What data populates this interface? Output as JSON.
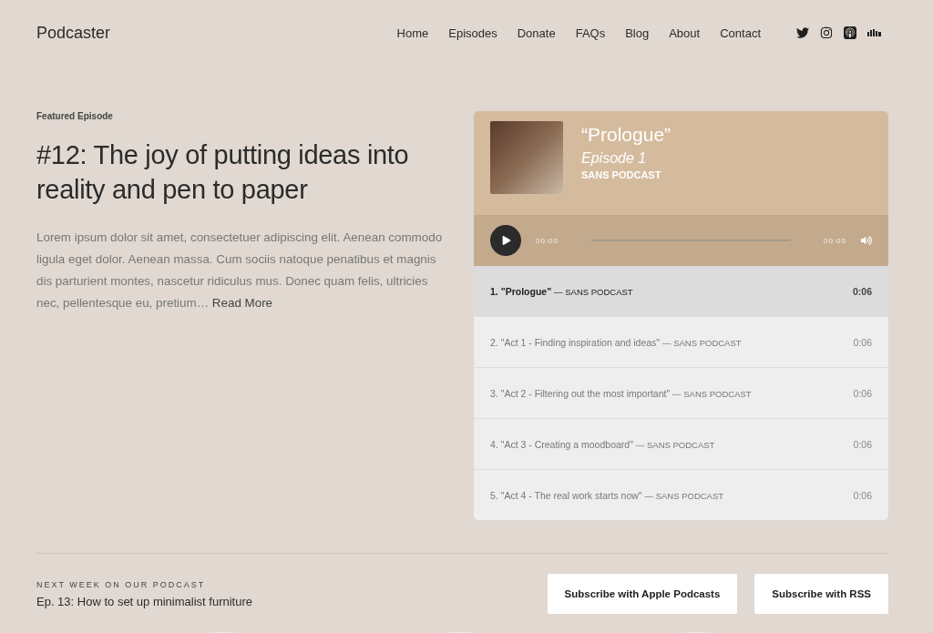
{
  "header": {
    "logo": "Podcaster",
    "nav": [
      {
        "label": "Home"
      },
      {
        "label": "Episodes"
      },
      {
        "label": "Donate"
      },
      {
        "label": "FAQs"
      },
      {
        "label": "Blog"
      },
      {
        "label": "About"
      },
      {
        "label": "Contact"
      }
    ],
    "social": [
      {
        "kind": "twitter"
      },
      {
        "kind": "instagram"
      },
      {
        "kind": "podcast"
      },
      {
        "kind": "soundcloud"
      }
    ]
  },
  "featured": {
    "eyebrow": "Featured Episode",
    "title": "#12: The joy of putting ideas into reality and pen to paper",
    "excerpt": "Lorem ipsum dolor sit amet, consectetuer adipiscing elit. Aenean commodo ligula eget dolor. Aenean massa. Cum sociis natoque penatibus et magnis dis parturient montes, nascetur ridiculus mus. Donec quam felis, ultricies nec, pellentesque eu, pretium…",
    "read_more": "Read More"
  },
  "player": {
    "title": "“Prologue”",
    "episode": "Episode 1",
    "artist": "SANS PODCAST",
    "elapsed": "00:00",
    "total": "00:00",
    "separator": "—",
    "tracks": [
      {
        "number": "1.",
        "title": "\"Prologue\"",
        "artist": "SANS PODCAST",
        "duration": "0:06",
        "selected": true
      },
      {
        "number": "2.",
        "title": "\"Act 1 - Finding inspiration and ideas\"",
        "artist": "SANS PODCAST",
        "duration": "0:06",
        "selected": false
      },
      {
        "number": "3.",
        "title": "\"Act 2 - Filtering out the most important\"",
        "artist": "SANS PODCAST",
        "duration": "0:06",
        "selected": false
      },
      {
        "number": "4.",
        "title": "\"Act 3 - Creating a moodboard\"",
        "artist": "SANS PODCAST",
        "duration": "0:06",
        "selected": false
      },
      {
        "number": "5.",
        "title": "\"Act 4 - The real work starts now\"",
        "artist": "SANS PODCAST",
        "duration": "0:06",
        "selected": false
      }
    ]
  },
  "next": {
    "eyebrow": "NEXT WEEK ON OUR PODCAST",
    "title": "Ep. 13: How to set up minimalist furniture"
  },
  "buttons": [
    {
      "label": "Subscribe with Apple Podcasts"
    },
    {
      "label": "Subscribe with RSS"
    }
  ]
}
